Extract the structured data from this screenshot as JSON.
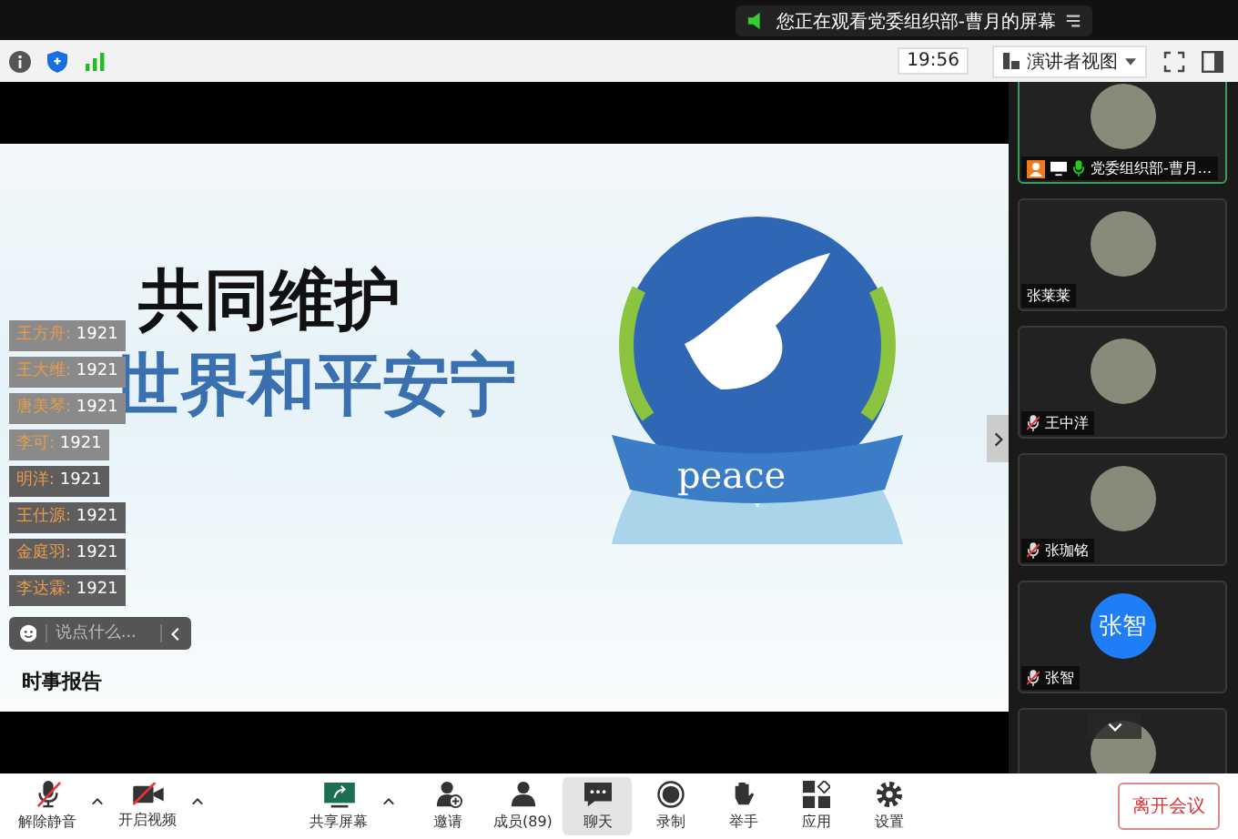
{
  "banner": {
    "text": "您正在观看党委组织部-曹月的屏幕"
  },
  "topbar": {
    "time": "19:56",
    "view_label": "演讲者视图"
  },
  "slide": {
    "title_line1": "共同维护",
    "title_line2": "世界和平安宁",
    "badge": "peace",
    "logo": "时事报告"
  },
  "chat": {
    "messages": [
      {
        "name": "王方舟:",
        "text": "1921",
        "faded": true
      },
      {
        "name": "王大维:",
        "text": "1921",
        "faded": true
      },
      {
        "name": "唐美琴:",
        "text": "1921",
        "faded": true
      },
      {
        "name": "李可:",
        "text": "1921",
        "faded": true
      },
      {
        "name": "明洋:",
        "text": "1921",
        "faded": false
      },
      {
        "name": "王仕源:",
        "text": "1921",
        "faded": false
      },
      {
        "name": "金庭羽:",
        "text": "1921",
        "faded": false
      },
      {
        "name": "李达霖:",
        "text": "1921",
        "faded": false
      }
    ],
    "input_placeholder": "说点什么..."
  },
  "participants": [
    {
      "name": "党委组织部-曹月...",
      "mic_icon": true,
      "muted": false,
      "host": true,
      "sharing": true,
      "speaking": true,
      "avatar": {
        "kind": "photo"
      }
    },
    {
      "name": "张莱莱",
      "mic_icon": false,
      "host": false,
      "sharing": false,
      "speaking": false,
      "avatar": {
        "kind": "photo"
      }
    },
    {
      "name": "王中洋",
      "mic_icon": true,
      "muted": true,
      "host": false,
      "sharing": false,
      "speaking": false,
      "avatar": {
        "kind": "photo"
      }
    },
    {
      "name": "张珈铭",
      "mic_icon": true,
      "muted": true,
      "host": false,
      "sharing": false,
      "speaking": false,
      "avatar": {
        "kind": "photo"
      }
    },
    {
      "name": "张智",
      "mic_icon": true,
      "muted": true,
      "host": false,
      "sharing": false,
      "speaking": false,
      "avatar": {
        "kind": "initials",
        "text": "张智"
      }
    }
  ],
  "toolbar": [
    {
      "kind": "mic",
      "label": "解除静音",
      "caret": true,
      "selected": false
    },
    {
      "kind": "video",
      "label": "开启视频",
      "caret": true,
      "selected": false
    },
    {
      "kind": "share",
      "label": "共享屏幕",
      "caret": true,
      "selected": false
    },
    {
      "kind": "invite",
      "label": "邀请",
      "caret": false,
      "selected": false
    },
    {
      "kind": "members",
      "label": "成员(89)",
      "caret": false,
      "selected": false
    },
    {
      "kind": "chat",
      "label": "聊天",
      "caret": false,
      "selected": true
    },
    {
      "kind": "record",
      "label": "录制",
      "caret": false,
      "selected": false
    },
    {
      "kind": "hand",
      "label": "举手",
      "caret": false,
      "selected": false
    },
    {
      "kind": "apps",
      "label": "应用",
      "caret": false,
      "selected": false
    },
    {
      "kind": "settings",
      "label": "设置",
      "caret": false,
      "selected": false
    }
  ],
  "leave_button": "离开会议"
}
